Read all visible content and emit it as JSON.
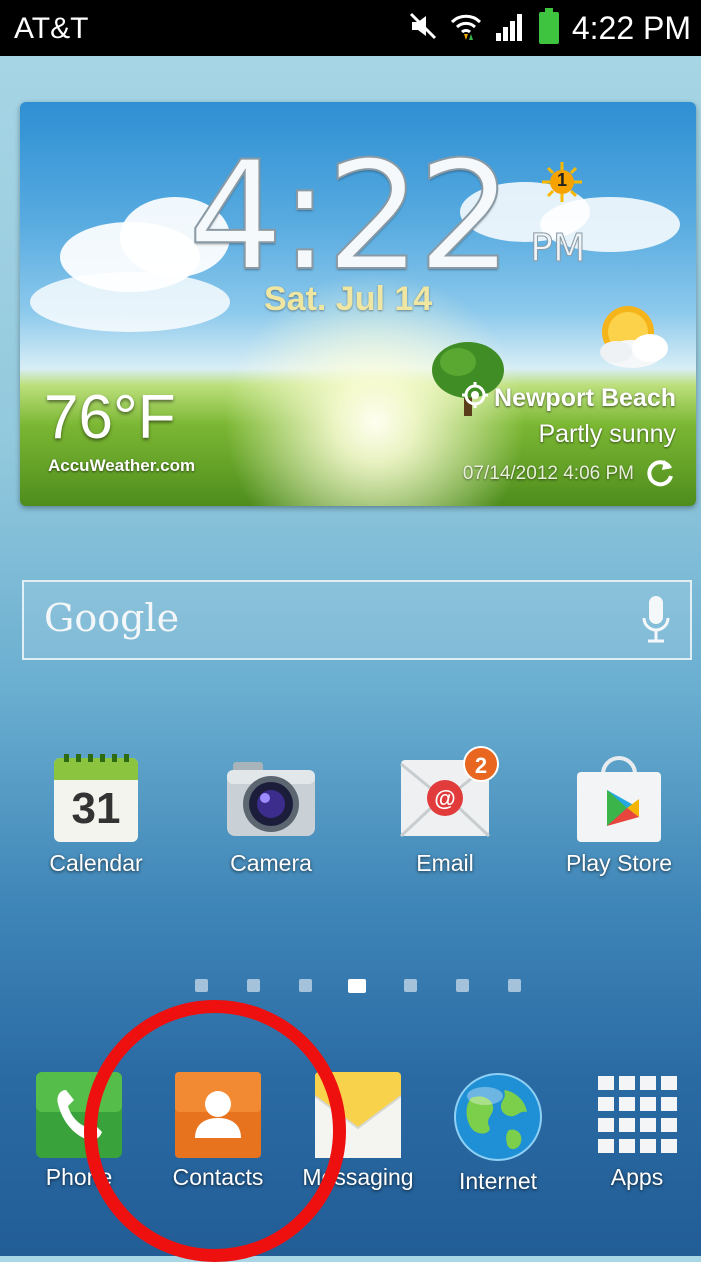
{
  "status_bar": {
    "carrier": "AT&T",
    "time": "4:22 PM",
    "icons": [
      "mute-icon",
      "wifi-icon",
      "signal-icon",
      "battery-icon"
    ]
  },
  "weather": {
    "time": "4:22",
    "ampm": "PM",
    "date": "Sat. Jul 14",
    "temperature": "76°F",
    "provider": "AccuWeather.com",
    "location": "Newport Beach",
    "condition": "Partly sunny",
    "updated": "07/14/2012 4:06 PM",
    "alert_badge": "1"
  },
  "search": {
    "placeholder": "Google"
  },
  "apps": [
    {
      "label": "Calendar",
      "icon": "calendar-icon",
      "day": "31"
    },
    {
      "label": "Camera",
      "icon": "camera-icon"
    },
    {
      "label": "Email",
      "icon": "email-icon",
      "badge": "2"
    },
    {
      "label": "Play Store",
      "icon": "play-store-icon"
    }
  ],
  "page_indicator": {
    "count": 7,
    "active": 4
  },
  "dock": [
    {
      "label": "Phone",
      "icon": "phone-icon"
    },
    {
      "label": "Contacts",
      "icon": "contacts-icon"
    },
    {
      "label": "Messaging",
      "icon": "messaging-icon"
    },
    {
      "label": "Internet",
      "icon": "internet-icon"
    },
    {
      "label": "Apps",
      "icon": "apps-grid-icon"
    }
  ],
  "annotation": {
    "target": "Contacts",
    "color": "#ee0f0f"
  }
}
